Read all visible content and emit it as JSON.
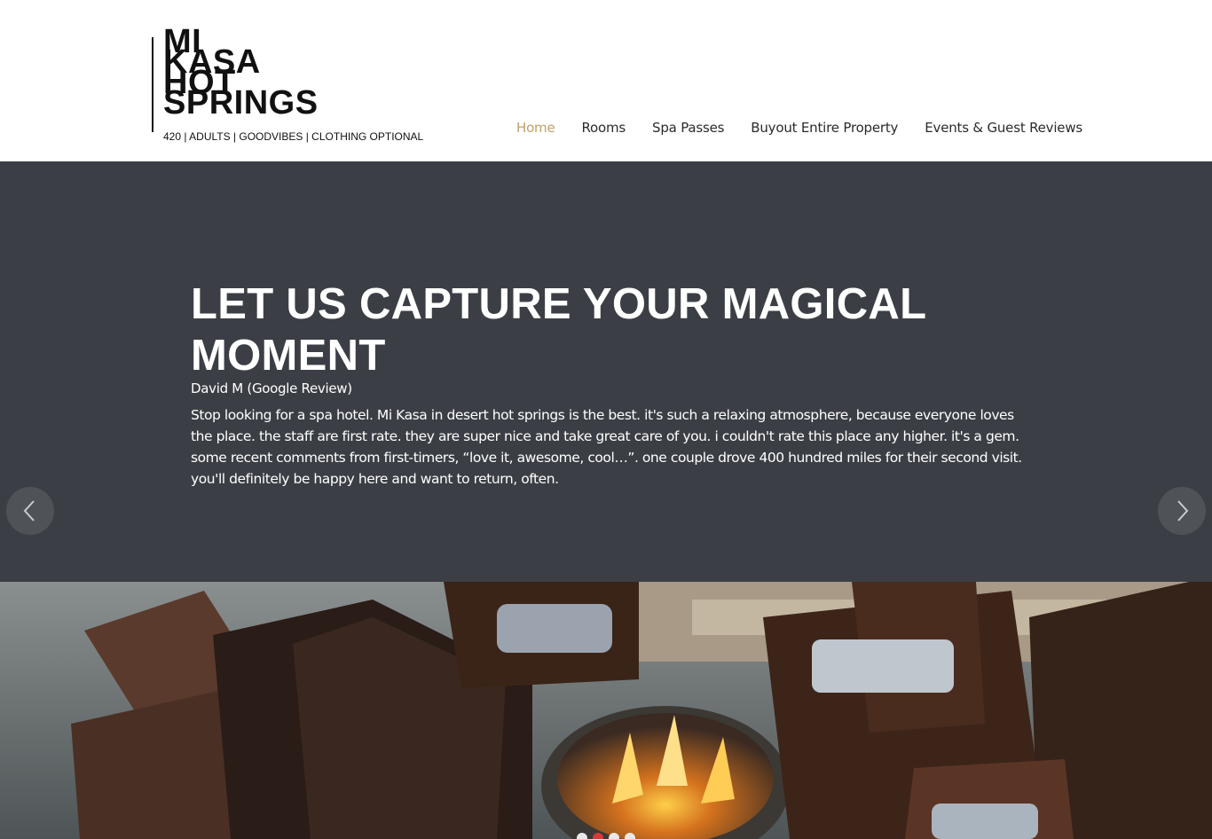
{
  "logo": {
    "lines": [
      "MI",
      "KASA",
      "HOT",
      "SPRINGS"
    ],
    "tagline": "420 | ADULTS | GOODVIBES | CLOTHING OPTIONAL"
  },
  "nav": {
    "items": [
      {
        "label": "Home",
        "active": true
      },
      {
        "label": "Rooms"
      },
      {
        "label": "Spa Passes"
      },
      {
        "label": "Buyout Entire Property"
      },
      {
        "label": "Events & Guest Reviews"
      }
    ]
  },
  "testimonial": {
    "title": "LET US CAPTURE YOUR MAGICAL MOMENT",
    "author": "David M (Google Review)",
    "text": "Stop looking for a spa hotel. Mi Kasa in desert hot springs is the best. it's such a relaxing atmosphere, because everyone loves the place. the staff are first rate. they are super nice and take great care of you. i couldn't rate this place any higher. it's a gem. some recent comments from first-timers, “love it, awesome, cool…”. one couple drove 400 hundred miles for their second visit. you'll definitely be happy here and want to return, often."
  },
  "slider": {
    "prev_icon": "chevron-left-icon",
    "next_icon": "chevron-right-icon",
    "dot_count": 4,
    "active_dot": 2
  },
  "colors": {
    "nav_active": "#c0a06a",
    "band_background": "#3b3f45",
    "dot_active": "#d63a3a"
  }
}
